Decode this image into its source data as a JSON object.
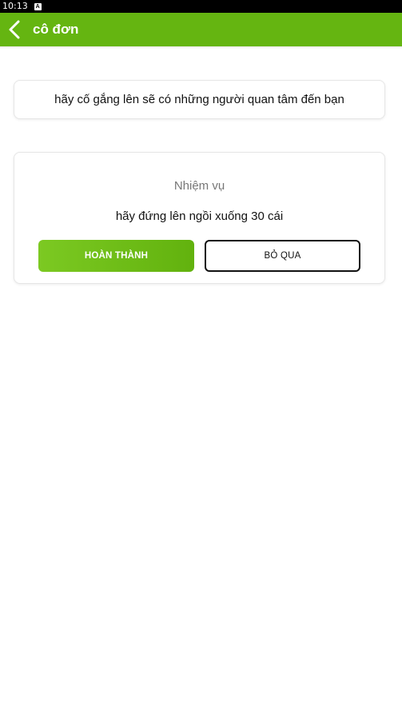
{
  "status_bar": {
    "time": "10:13",
    "indicator_icon": "a-notification-icon",
    "indicator_glyph": "A"
  },
  "app_bar": {
    "title": "cô đơn",
    "back_icon": "chevron-left-icon",
    "color": "#65b511"
  },
  "quote": {
    "text": "hãy cố gắng lên sẽ có những người quan tâm đến bạn"
  },
  "task": {
    "heading": "Nhiệm vụ",
    "description": "hãy đứng lên ngồi xuống 30 cái",
    "complete_label": "HOÀN THÀNH",
    "skip_label": "BỎ QUA"
  }
}
